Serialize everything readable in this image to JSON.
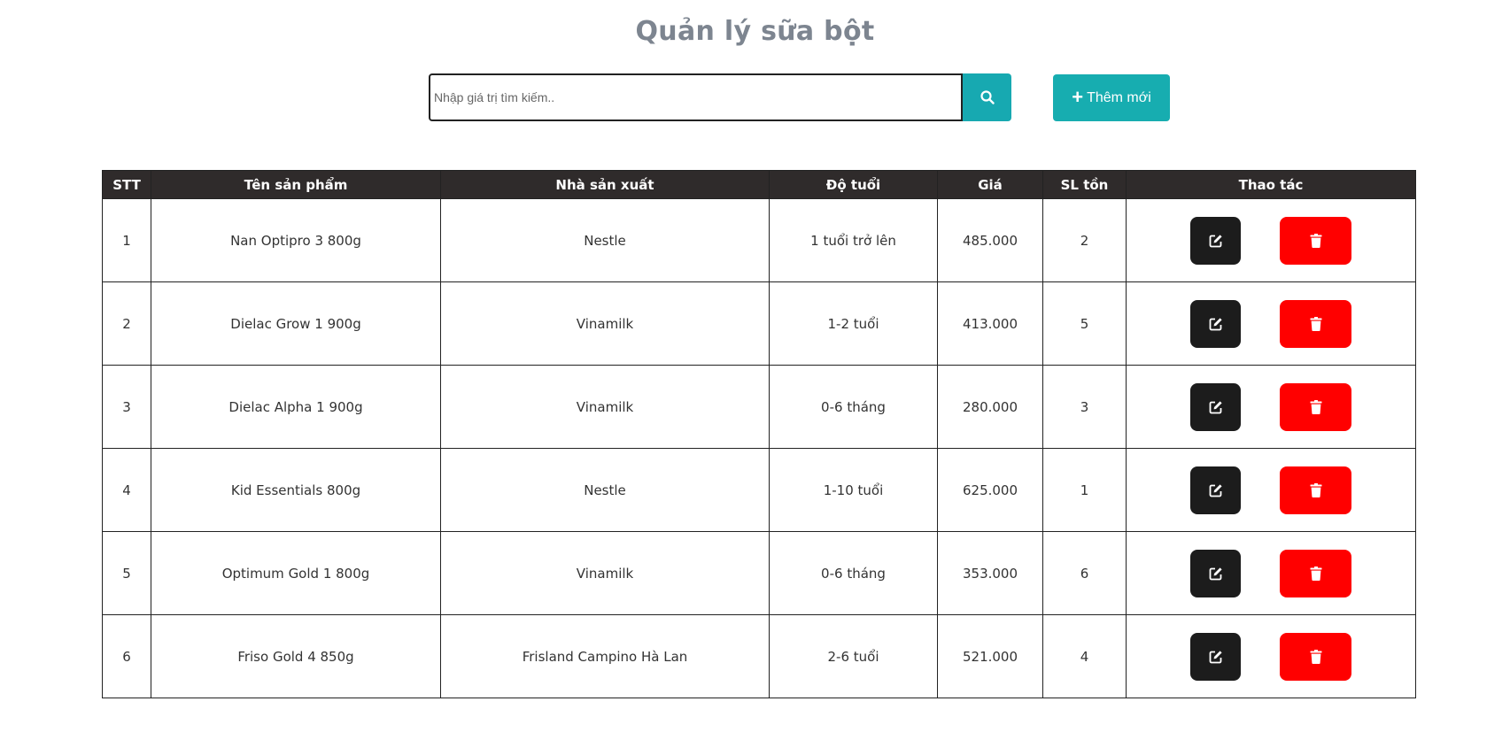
{
  "page": {
    "title": "Quản lý sữa bột"
  },
  "search": {
    "placeholder": "Nhập giá trị tìm kiếm..",
    "button_icon": "search-icon"
  },
  "add_button": {
    "label": "Thêm mới",
    "icon": "plus-icon"
  },
  "table": {
    "headers": [
      "STT",
      "Tên sản phẩm",
      "Nhà sản xuất",
      "Độ tuổi",
      "Giá",
      "SL tồn",
      "Thao tác"
    ],
    "rows": [
      {
        "stt": "1",
        "name": "Nan Optipro 3 800g",
        "maker": "Nestle",
        "age": "1 tuổi trở lên",
        "price": "485.000",
        "stock": "2"
      },
      {
        "stt": "2",
        "name": "Dielac Grow 1 900g",
        "maker": "Vinamilk",
        "age": "1-2 tuổi",
        "price": "413.000",
        "stock": "5"
      },
      {
        "stt": "3",
        "name": "Dielac Alpha 1 900g",
        "maker": "Vinamilk",
        "age": "0-6 tháng",
        "price": "280.000",
        "stock": "3"
      },
      {
        "stt": "4",
        "name": "Kid Essentials 800g",
        "maker": "Nestle",
        "age": "1-10 tuổi",
        "price": "625.000",
        "stock": "1"
      },
      {
        "stt": "5",
        "name": "Optimum Gold 1 800g",
        "maker": "Vinamilk",
        "age": "0-6 tháng",
        "price": "353.000",
        "stock": "6"
      },
      {
        "stt": "6",
        "name": "Friso Gold 4 850g",
        "maker": "Frisland Campino Hà Lan",
        "age": "2-6 tuổi",
        "price": "521.000",
        "stock": "4"
      }
    ],
    "action_icons": {
      "edit": "edit-icon",
      "delete": "trash-icon"
    }
  },
  "colors": {
    "accent": "#17a9b1",
    "header_bg": "#2f2b2b",
    "edit_bg": "#1c1c1c",
    "delete_bg": "#ff0000",
    "title": "#7d8590"
  }
}
